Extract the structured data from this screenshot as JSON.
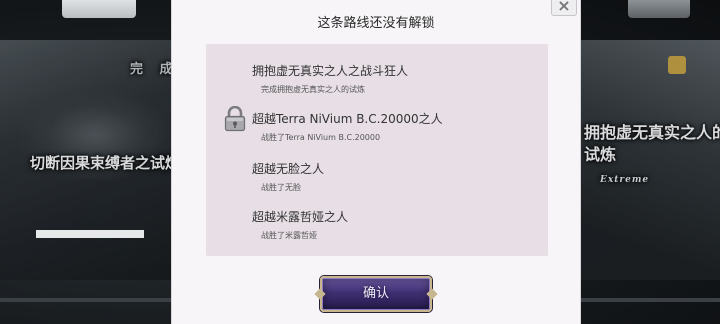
{
  "background": {
    "complete_text": "完 成",
    "left_trial_title": "切断因果束缚者之试炼",
    "right_trial_title_line1": "拥抱虚无真实之人的",
    "right_trial_title_line2": "试炼",
    "right_trial_subtitle": "Extreme"
  },
  "dialog": {
    "title": "这条路线还没有解锁",
    "close_icon": "close-icon",
    "lock_icon": "padlock-icon",
    "routes": [
      {
        "name": "拥抱虚无真实之人之战斗狂人",
        "condition": "完成拥抱虚无真实之人的试炼",
        "locked": false
      },
      {
        "name": "超越Terra NiVium B.C.20000之人",
        "condition": "战胜了Terra NiVium B.C.20000",
        "locked": true
      },
      {
        "name": "超越无脸之人",
        "condition": "战胜了无脸",
        "locked": false
      },
      {
        "name": "超越米露哲娅之人",
        "condition": "战胜了米露哲娅",
        "locked": false
      }
    ],
    "confirm_label": "确认"
  },
  "colors": {
    "panel_bg": "#e7dfe5",
    "dialog_bg": "#f7f5f7",
    "button_purple": "#3f2f72",
    "button_gold_border": "#c8b78e"
  }
}
